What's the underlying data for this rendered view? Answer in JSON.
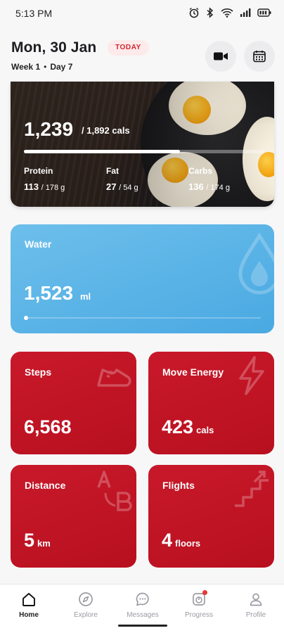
{
  "status_bar": {
    "time": "5:13 PM"
  },
  "header": {
    "date_title": "Mon, 30 Jan",
    "today_badge": "TODAY",
    "week_label": "Week 1",
    "day_label": "Day 7",
    "separator": "•"
  },
  "calories": {
    "consumed": "1,239",
    "goal": "/ 1,892 cals",
    "progress_fraction": 0.65,
    "macros": [
      {
        "label": "Protein",
        "value": "113",
        "goal": "/ 178 g"
      },
      {
        "label": "Fat",
        "value": "27",
        "goal": "/ 54 g"
      },
      {
        "label": "Carbs",
        "value": "136",
        "goal": "/ 174 g"
      }
    ]
  },
  "water": {
    "label": "Water",
    "value": "1,523",
    "unit": "ml"
  },
  "tiles": {
    "steps": {
      "label": "Steps",
      "value": "6,568",
      "unit": ""
    },
    "energy": {
      "label": "Move Energy",
      "value": "423",
      "unit": "cals"
    },
    "distance": {
      "label": "Distance",
      "value": "5",
      "unit": "km"
    },
    "flights": {
      "label": "Flights",
      "value": "4",
      "unit": "floors"
    }
  },
  "nav": {
    "home": "Home",
    "explore": "Explore",
    "messages": "Messages",
    "progress": "Progress",
    "profile": "Profile"
  },
  "colors": {
    "accent_red": "#c8192a",
    "water_blue": "#4aa9e2",
    "badge_red": "#d3262f"
  }
}
